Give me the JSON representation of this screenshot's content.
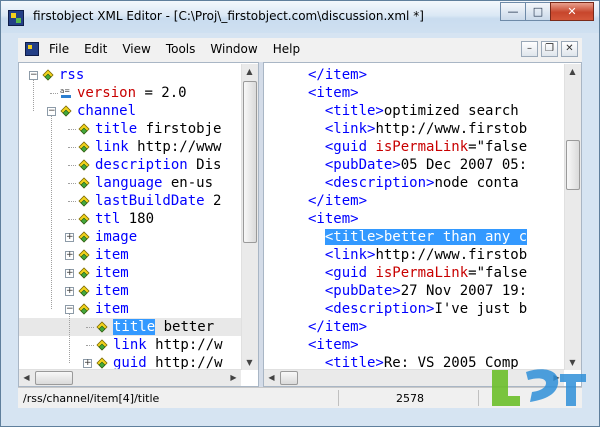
{
  "window": {
    "title": "firstobject XML Editor - [C:\\Proj\\_firstobject.com\\discussion.xml *]",
    "caption_buttons": [
      "minimize",
      "maximize",
      "close"
    ]
  },
  "menu": {
    "items": [
      "File",
      "Edit",
      "View",
      "Tools",
      "Window",
      "Help"
    ],
    "mdi_buttons": [
      "minimize",
      "restore",
      "close"
    ]
  },
  "tree": {
    "rows": [
      {
        "expander": "minus",
        "icon": "element-icon",
        "name": "rss",
        "value": ""
      },
      {
        "expander": "",
        "icon": "attribute-icon",
        "name": "version",
        "value": " = 2.0",
        "kind": "attr"
      },
      {
        "expander": "minus",
        "icon": "element-icon",
        "name": "channel",
        "value": ""
      },
      {
        "expander": "",
        "icon": "element-icon",
        "name": "title",
        "value": " firstobje"
      },
      {
        "expander": "",
        "icon": "element-icon",
        "name": "link",
        "value": " http://www"
      },
      {
        "expander": "",
        "icon": "element-icon",
        "name": "description",
        "value": " Dis"
      },
      {
        "expander": "",
        "icon": "element-icon",
        "name": "language",
        "value": " en-us"
      },
      {
        "expander": "",
        "icon": "element-icon",
        "name": "lastBuildDate",
        "value": " 2"
      },
      {
        "expander": "",
        "icon": "element-icon",
        "name": "ttl",
        "value": " 180"
      },
      {
        "expander": "plus",
        "icon": "element-icon",
        "name": "image",
        "value": ""
      },
      {
        "expander": "plus",
        "icon": "element-icon",
        "name": "item",
        "value": ""
      },
      {
        "expander": "plus",
        "icon": "element-icon",
        "name": "item",
        "value": ""
      },
      {
        "expander": "plus",
        "icon": "element-icon",
        "name": "item",
        "value": ""
      },
      {
        "expander": "minus",
        "icon": "element-icon",
        "name": "item",
        "value": ""
      },
      {
        "expander": "",
        "icon": "element-icon",
        "name": "title",
        "value": " better",
        "selected": true
      },
      {
        "expander": "",
        "icon": "element-icon",
        "name": "link",
        "value": " http://w"
      },
      {
        "expander": "plus",
        "icon": "element-icon",
        "name": "guid",
        "value": " http://w"
      }
    ]
  },
  "xml": {
    "lines": [
      [
        {
          "t": "</item>",
          "c": "tag"
        }
      ],
      [
        {
          "t": "<item>",
          "c": "tag"
        }
      ],
      [
        {
          "t": "  <title>",
          "c": "tag"
        },
        {
          "t": "optimized search",
          "c": "text"
        }
      ],
      [
        {
          "t": "  <link>",
          "c": "tag"
        },
        {
          "t": "http://www.firstob",
          "c": "text"
        }
      ],
      [
        {
          "t": "  <guid ",
          "c": "tag"
        },
        {
          "t": "isPermaLink",
          "c": "attr"
        },
        {
          "t": "=\"false",
          "c": "text"
        }
      ],
      [
        {
          "t": "  <pubDate>",
          "c": "tag"
        },
        {
          "t": "05 Dec 2007 05:",
          "c": "text"
        }
      ],
      [
        {
          "t": "  <description>",
          "c": "tag"
        },
        {
          "t": "node conta",
          "c": "text"
        }
      ],
      [
        {
          "t": "</item>",
          "c": "tag"
        }
      ],
      [
        {
          "t": "<item>",
          "c": "tag"
        }
      ],
      [
        {
          "t": "  <title>better than any c",
          "c": "tag",
          "selected": true
        }
      ],
      [
        {
          "t": "  <link>",
          "c": "tag"
        },
        {
          "t": "http://www.firstob",
          "c": "text"
        }
      ],
      [
        {
          "t": "  <guid ",
          "c": "tag"
        },
        {
          "t": "isPermaLink",
          "c": "attr"
        },
        {
          "t": "=\"false",
          "c": "text"
        }
      ],
      [
        {
          "t": "  <pubDate>",
          "c": "tag"
        },
        {
          "t": "27 Nov 2007 19:",
          "c": "text"
        }
      ],
      [
        {
          "t": "  <description>",
          "c": "tag"
        },
        {
          "t": "I've just b",
          "c": "text"
        }
      ],
      [
        {
          "t": "</item>",
          "c": "tag"
        }
      ],
      [
        {
          "t": "<item>",
          "c": "tag"
        }
      ],
      [
        {
          "t": "  <title>",
          "c": "tag"
        },
        {
          "t": "Re: VS 2005 Comp",
          "c": "text"
        }
      ]
    ]
  },
  "status": {
    "path": "/rss/channel/item[4]/title",
    "offset": "2578"
  },
  "colors": {
    "tag": "#0000ff",
    "attr": "#c80000",
    "text": "#000000",
    "selection": "#3399ff"
  }
}
